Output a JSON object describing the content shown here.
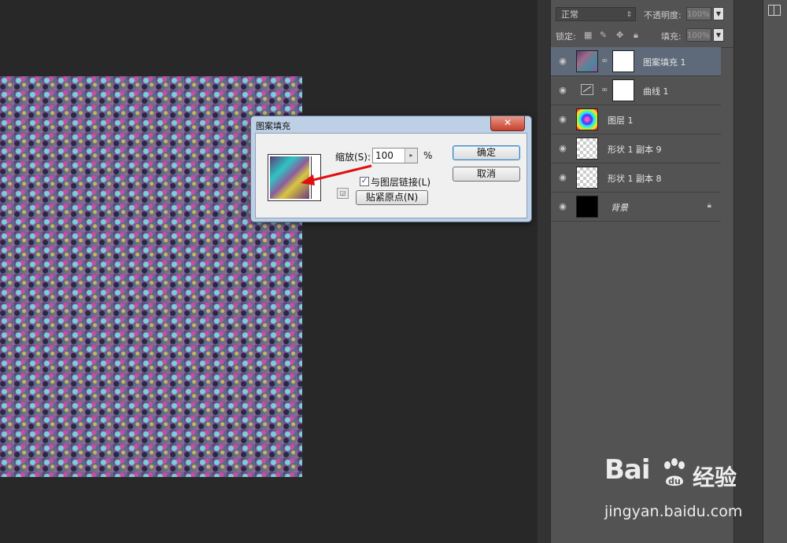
{
  "layers_panel": {
    "blend_mode": "正常",
    "opacity_label": "不透明度:",
    "opacity_value": "100%",
    "lock_label": "锁定:",
    "fill_label": "填充:",
    "fill_value": "100%",
    "layers": [
      {
        "name": "图案填充 1",
        "selected": true
      },
      {
        "name": "曲线 1",
        "selected": false
      },
      {
        "name": "图层 1",
        "selected": false
      },
      {
        "name": "形状 1 副本 9",
        "selected": false
      },
      {
        "name": "形状 1 副本 8",
        "selected": false
      },
      {
        "name": "背景",
        "selected": false,
        "locked": true
      }
    ]
  },
  "dialog": {
    "title": "图案填充",
    "close_symbol": "✕",
    "scale_label": "缩放(S):",
    "scale_value": "100",
    "scale_unit": "%",
    "link_checkbox_label": "与图层链接(L)",
    "link_checked": true,
    "snap_origin_button": "贴紧原点(N)",
    "ok_button": "确定",
    "cancel_button": "取消"
  },
  "watermark": {
    "logo_text": "Bai",
    "logo_suffix": "经验",
    "url": "jingyan.baidu.com"
  },
  "colors": {
    "app_bg": "#282828",
    "panel_bg": "#535353",
    "selected_layer": "#5e6a79",
    "dialog_frame": "#bdd0e6",
    "annotation_arrow": "#e01010"
  },
  "icons": [
    "eye-icon",
    "link-chain-icon",
    "lock-icon",
    "curves-adjustment-icon",
    "close-icon",
    "move-icon",
    "brush-icon",
    "transparency-lock-icon",
    "stepper-arrow-icon",
    "arrange-icon"
  ]
}
